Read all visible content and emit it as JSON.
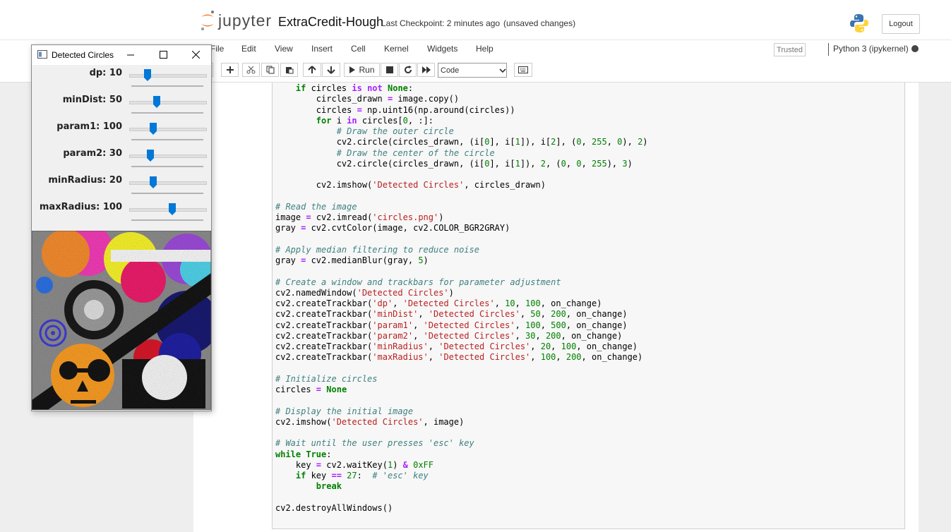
{
  "header": {
    "logo_text": "jupyter",
    "notebook_name": "ExtraCredit-Hough",
    "checkpoint": "Last Checkpoint: 2 minutes ago",
    "save_status": "(unsaved changes)",
    "logout_label": "Logout"
  },
  "menu": {
    "items": [
      "File",
      "Edit",
      "View",
      "Insert",
      "Cell",
      "Kernel",
      "Widgets",
      "Help"
    ],
    "trusted": "Trusted",
    "kernel": "Python 3 (ipykernel)"
  },
  "toolbar": {
    "run_label": "Run",
    "cell_type": "Code"
  },
  "cv_window": {
    "title": "Detected Circles",
    "trackbars": [
      {
        "label": "dp: 10",
        "value": 10,
        "max": 100
      },
      {
        "label": "minDist: 50",
        "value": 50,
        "max": 200
      },
      {
        "label": "param1: 100",
        "value": 100,
        "max": 500
      },
      {
        "label": "param2: 30",
        "value": 30,
        "max": 200
      },
      {
        "label": "minRadius: 20",
        "value": 20,
        "max": 100
      },
      {
        "label": "maxRadius: 100",
        "value": 100,
        "max": 200
      }
    ]
  },
  "code_lines": [
    "    if circles is not None:",
    "        circles_drawn = image.copy()",
    "        circles = np.uint16(np.around(circles))",
    "        for i in circles[0, :]:",
    "            # Draw the outer circle",
    "            cv2.circle(circles_drawn, (i[0], i[1]), i[2], (0, 255, 0), 2)",
    "            # Draw the center of the circle",
    "            cv2.circle(circles_drawn, (i[0], i[1]), 2, (0, 0, 255), 3)",
    "",
    "        cv2.imshow('Detected Circles', circles_drawn)",
    "",
    "# Read the image",
    "image = cv2.imread('circles.png')",
    "gray = cv2.cvtColor(image, cv2.COLOR_BGR2GRAY)",
    "",
    "# Apply median filtering to reduce noise",
    "gray = cv2.medianBlur(gray, 5)",
    "",
    "# Create a window and trackbars for parameter adjustment",
    "cv2.namedWindow('Detected Circles')",
    "cv2.createTrackbar('dp', 'Detected Circles', 10, 100, on_change)",
    "cv2.createTrackbar('minDist', 'Detected Circles', 50, 200, on_change)",
    "cv2.createTrackbar('param1', 'Detected Circles', 100, 500, on_change)",
    "cv2.createTrackbar('param2', 'Detected Circles', 30, 200, on_change)",
    "cv2.createTrackbar('minRadius', 'Detected Circles', 20, 100, on_change)",
    "cv2.createTrackbar('maxRadius', 'Detected Circles', 100, 200, on_change)",
    "",
    "# Initialize circles",
    "circles = None",
    "",
    "# Display the initial image",
    "cv2.imshow('Detected Circles', image)",
    "",
    "# Wait until the user presses 'esc' key",
    "while True:",
    "    key = cv2.waitKey(1) & 0xFF",
    "    if key == 27:  # 'esc' key",
    "        break",
    "",
    "cv2.destroyAllWindows()"
  ],
  "colors": {
    "accent": "#0078d7",
    "keyword": "#008000",
    "string": "#ba2121",
    "comment": "#408080",
    "jupyter_orange": "#f37726"
  }
}
